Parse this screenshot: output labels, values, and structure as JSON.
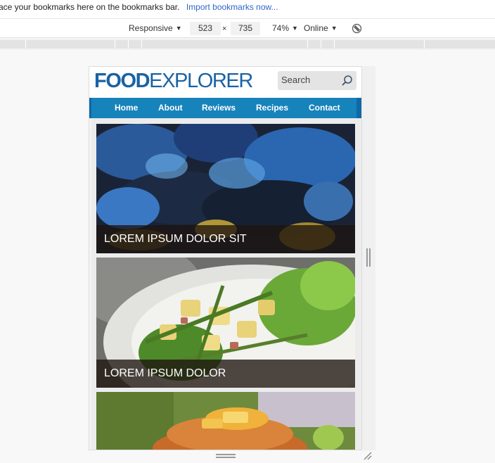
{
  "bookmarks_bar": {
    "message": "ace your bookmarks here on the bookmarks bar.",
    "import_link": "Import bookmarks now..."
  },
  "device_toolbar": {
    "device": "Responsive",
    "width": "523",
    "separator": "×",
    "height": "735",
    "zoom": "74%",
    "network": "Online",
    "caret": "▼",
    "rotate_icon": "rotate-icon"
  },
  "site": {
    "logo_bold": "FOOD",
    "logo_light": "EXPLORER",
    "search_placeholder": "Search",
    "nav": [
      "Home",
      "About",
      "Reviews",
      "Recipes",
      "Contact"
    ],
    "cards": [
      {
        "caption": "LOREM IPSUM DOLOR SIT",
        "image": "mussels-photo"
      },
      {
        "caption": "LOREM IPSUM DOLOR",
        "image": "potato-salad-photo"
      },
      {
        "caption": "",
        "image": "pancakes-photo"
      }
    ]
  },
  "colors": {
    "brand_blue": "#1a62a4",
    "nav_blue": "#1783bb",
    "link_blue": "#2f67c7"
  }
}
